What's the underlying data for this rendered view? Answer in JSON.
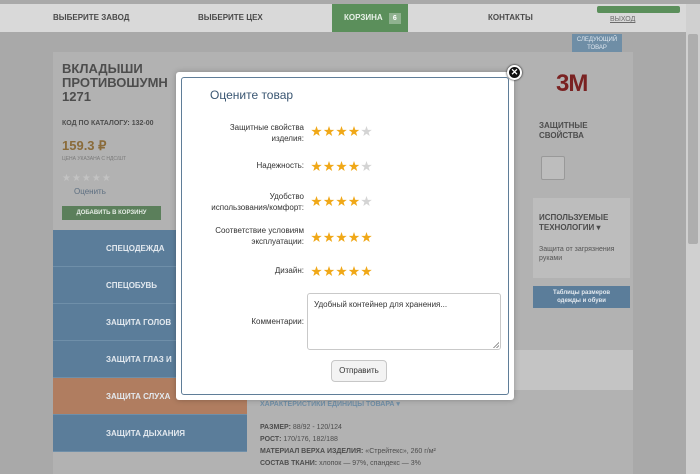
{
  "nav": {
    "choose_plant": "ВЫБЕРИТЕ ЗАВОД",
    "choose_shop": "ВЫБЕРИТЕ ЦЕХ",
    "cart_label": "КОРЗИНА",
    "cart_count": "6",
    "contacts": "КОНТАКТЫ",
    "logout": "ВЫХОД"
  },
  "next_product": {
    "line1": "СЛЕДУЮЩИЙ",
    "line2": "ТОВАР"
  },
  "product": {
    "title_line1": "ВКЛАДЫШИ",
    "title_line2": "ПРОТИВОШУМН",
    "title_line3": "1271",
    "code": "КОД ПО КАТАЛОГУ: 132-00",
    "price": "159.3 ₽",
    "price_note": "ЦЕНА УКАЗАНА С НДС/ШТ",
    "rating_empty": "★★★★★",
    "rate_link": "Оценить",
    "add_to_cart": "ДОБАВИТЬ В КОРЗИНУ"
  },
  "categories": [
    {
      "label": "СПЕЦОДЕЖДА",
      "active": false
    },
    {
      "label": "СПЕЦОБУВЬ",
      "active": false
    },
    {
      "label": "ЗАЩИТА ГОЛОВ",
      "active": false
    },
    {
      "label": "ЗАЩИТА ГЛАЗ И",
      "active": false
    },
    {
      "label": "ЗАЩИТА СЛУХА",
      "active": true
    },
    {
      "label": "ЗАЩИТА ДЫХАНИЯ",
      "active": false
    }
  ],
  "side": {
    "brand": "3M",
    "protect_line1": "ЗАЩИТНЫЕ",
    "protect_line2": "СВОЙСТВА",
    "tech_line1": "ИСПОЛЬЗУЕМЫЕ",
    "tech_line2": "ТЕХНОЛОГИИ ▾",
    "tech_link": "Защита от загрязнения руками",
    "sizes_line1": "Таблицы размеров",
    "sizes_line2": "одежды и обуви"
  },
  "characteristics": {
    "title": "ХАРАКТЕРИСТИКИ ЕДИНИЦЫ ТОВАРА ▾",
    "lines": [
      {
        "key": "РАЗМЕР:",
        "value": " 88/92 - 120/124"
      },
      {
        "key": "РОСТ:",
        "value": " 170/176, 182/188"
      },
      {
        "key": "МАТЕРИАЛ ВЕРХА ИЗДЕЛИЯ:",
        "value": " «Стрейтекс», 260 г/м²"
      },
      {
        "key": "СОСТАВ ТКАНИ:",
        "value": " хлопок — 97%, спандекс — 3%"
      }
    ]
  },
  "modal": {
    "title": "Оцените товар",
    "close": "✕",
    "criteria": [
      {
        "line1": "Защитные свойства",
        "line2": "изделия:",
        "rating": 4
      },
      {
        "line1": "Надежность:",
        "line2": "",
        "rating": 4
      },
      {
        "line1": "Удобство",
        "line2": "использования/комфорт:",
        "rating": 4
      },
      {
        "line1": "Соответствие условиям",
        "line2": "эксплуатации:",
        "rating": 5
      },
      {
        "line1": "Дизайн:",
        "line2": "",
        "rating": 5
      }
    ],
    "comment_label": "Комментарии:",
    "comment_value": "Удобный контейнер для хранения...",
    "submit": "Отправить"
  },
  "colors": {
    "accent_blue": "#3a5672",
    "star_on": "#f0a818",
    "star_off": "#d4d4d4",
    "cart_green": "#5b8f5b"
  },
  "icons": [
    "close-icon",
    "star-icon",
    "chevron-down-icon"
  ]
}
